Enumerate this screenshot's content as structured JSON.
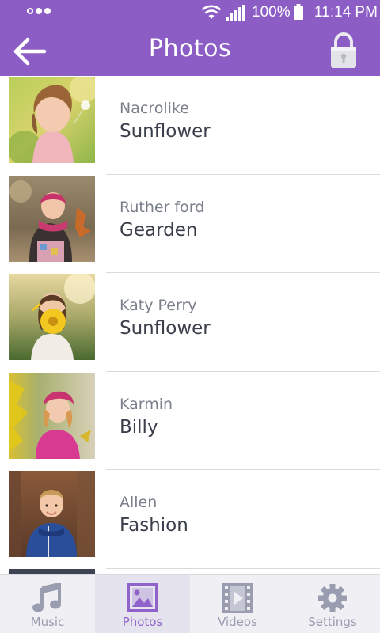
{
  "status_bar": {
    "battery": "100%",
    "time": "11:14 PM"
  },
  "header": {
    "title": "Photos",
    "back_icon": "arrow-left-icon",
    "lock_icon": "lock-icon"
  },
  "colors": {
    "primary": "#8d5dc6",
    "nav_active": "#8f63c9",
    "nav_inactive": "#9a9cb0"
  },
  "photos": {
    "items": [
      {
        "subtitle": "Nacrolike",
        "title": "Sunflower"
      },
      {
        "subtitle": "Ruther ford",
        "title": "Gearden"
      },
      {
        "subtitle": "Katy Perry",
        "title": "Sunflower"
      },
      {
        "subtitle": "Karmin",
        "title": "Billy"
      },
      {
        "subtitle": "Allen",
        "title": "Fashion"
      }
    ]
  },
  "bottom_nav": {
    "items": [
      {
        "label": "Music",
        "icon": "music-note-icon",
        "active": false
      },
      {
        "label": "Photos",
        "icon": "image-icon",
        "active": true
      },
      {
        "label": "Videos",
        "icon": "film-icon",
        "active": false
      },
      {
        "label": "Settings",
        "icon": "gear-icon",
        "active": false
      }
    ]
  }
}
